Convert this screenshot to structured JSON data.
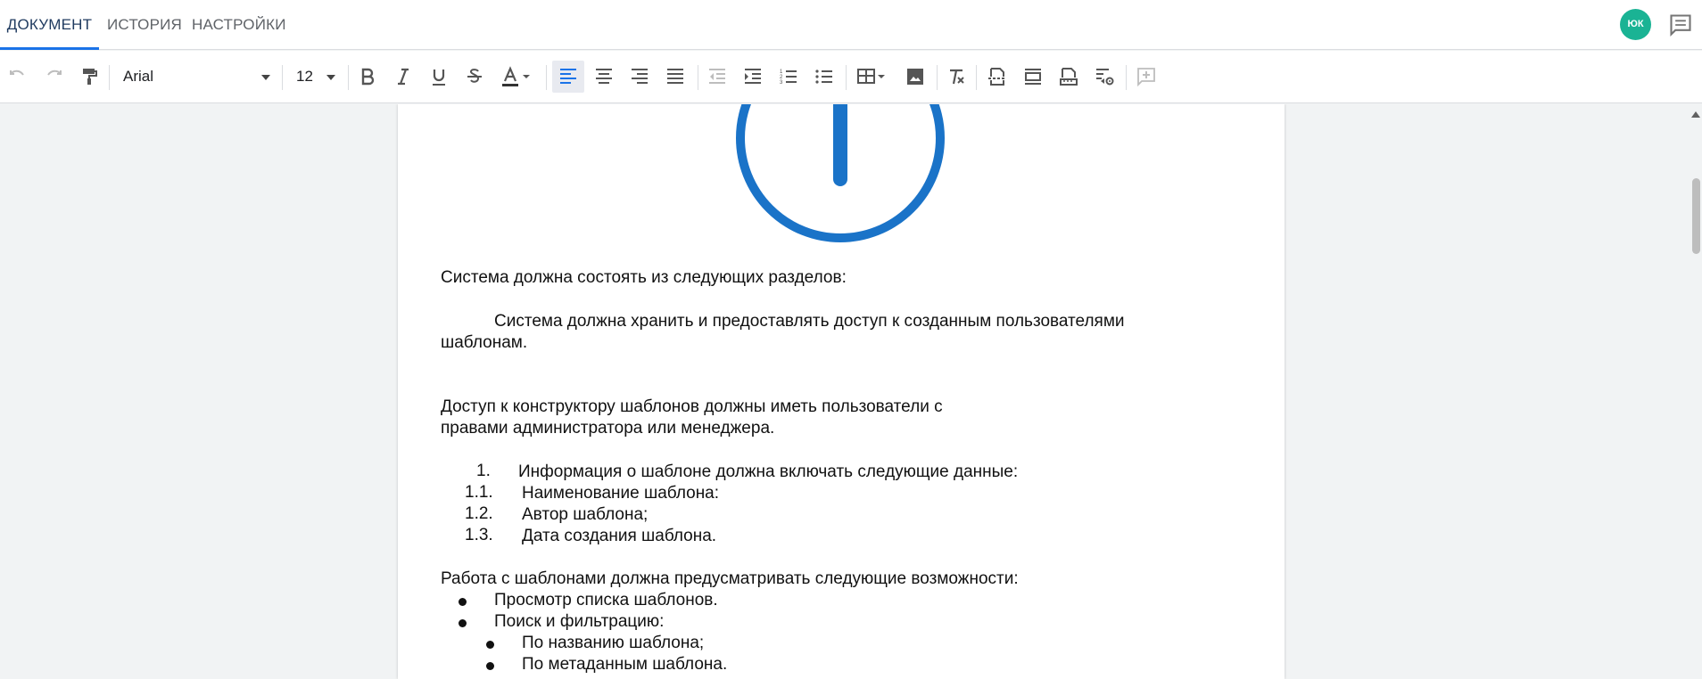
{
  "tabs": {
    "document": "ДОКУМЕНТ",
    "history": "ИСТОРИЯ",
    "settings": "НАСТРОЙКИ"
  },
  "user": {
    "initials": "ЮК",
    "avatar_color": "#1ab394"
  },
  "toolbar": {
    "font": "Arial",
    "font_size": "12",
    "icons": [
      "undo-icon",
      "redo-icon",
      "paint-format-icon",
      "bold-icon",
      "italic-icon",
      "underline-icon",
      "strikethrough-icon",
      "text-color-icon",
      "align-left-icon",
      "align-center-icon",
      "align-right-icon",
      "align-justify-icon",
      "outdent-icon",
      "indent-icon",
      "numbered-list-icon",
      "bulleted-list-icon",
      "table-icon",
      "image-icon",
      "clear-formatting-icon",
      "page-break-icon",
      "section-icon",
      "ruler-icon",
      "page-settings-icon",
      "add-comment-icon"
    ],
    "accent": "#1a73e8"
  },
  "document": {
    "p1": "Система должна состоять из следующих разделов:",
    "p2_line1": "Система должна хранить и предоставлять доступ к созданным пользователями",
    "p2_line2": "шаблонам.",
    "p3_line1": "Доступ к конструктору шаблонов должны иметь пользователи с",
    "p3_line2": "правами администратора или менеджера.",
    "numbered": [
      {
        "num": "1.",
        "text": "Информация о шаблоне должна включать следующие данные:"
      },
      {
        "num": "1.1.",
        "text": "Наименование шаблона:"
      },
      {
        "num": "1.2.",
        "text": "Автор шаблона;"
      },
      {
        "num": "1.3.",
        "text": "Дата создания шаблона."
      }
    ],
    "p4": "Работа с шаблонами должна предусматривать следующие возможности:",
    "bullets": [
      {
        "text": "Просмотр списка шаблонов."
      },
      {
        "text": "Поиск и фильтрацию:"
      }
    ],
    "sub_bullets": [
      {
        "text": "По названию шаблона;"
      },
      {
        "text": "По метаданным шаблона."
      }
    ],
    "info_icon_color": "#1a73c8"
  }
}
